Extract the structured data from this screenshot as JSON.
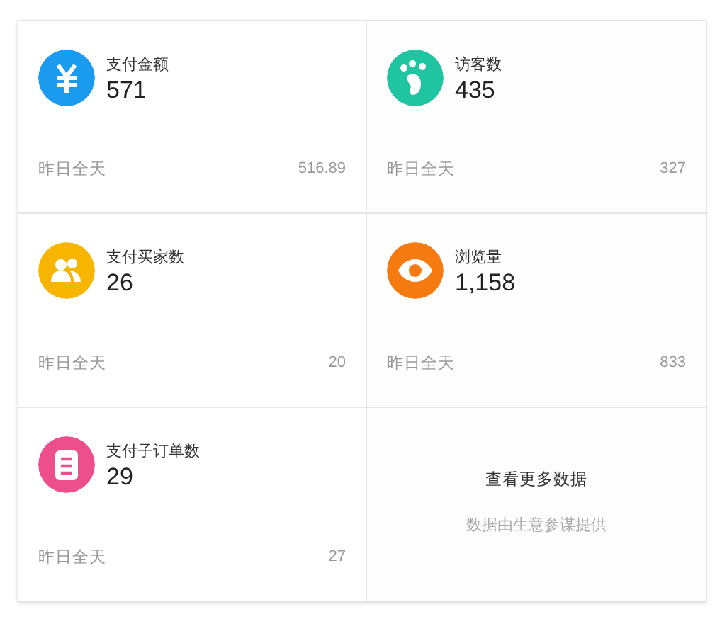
{
  "metrics": [
    {
      "kind": "yuan",
      "color": "#1a9bef",
      "label": "支付金额",
      "value": "571",
      "period": "昨日全天",
      "previous": "516.89"
    },
    {
      "kind": "paw",
      "color": "#1fc4a0",
      "label": "访客数",
      "value": "435",
      "period": "昨日全天",
      "previous": "327"
    },
    {
      "kind": "people",
      "color": "#f7b500",
      "label": "支付买家数",
      "value": "26",
      "period": "昨日全天",
      "previous": "20"
    },
    {
      "kind": "eye",
      "color": "#f57a0f",
      "label": "浏览量",
      "value": "1,158",
      "period": "昨日全天",
      "previous": "833"
    },
    {
      "kind": "clipboard",
      "color": "#ec4f8b",
      "label": "支付子订单数",
      "value": "29",
      "period": "昨日全天",
      "previous": "27"
    }
  ],
  "more": {
    "link": "查看更多数据",
    "note": "数据由生意参谋提供"
  }
}
